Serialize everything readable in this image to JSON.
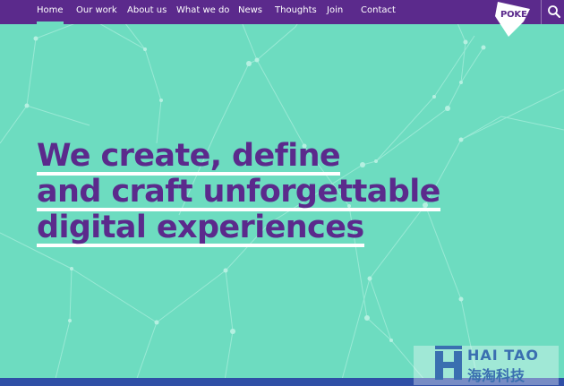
{
  "nav": {
    "items": [
      {
        "label": "Home",
        "active": true
      },
      {
        "label": "Our work",
        "active": false
      },
      {
        "label": "About us",
        "active": false
      },
      {
        "label": "What we do",
        "active": false
      },
      {
        "label": "News",
        "active": false
      },
      {
        "label": "Thoughts",
        "active": false
      },
      {
        "label": "Join",
        "active": false
      },
      {
        "label": "Contact",
        "active": false
      }
    ]
  },
  "logo": {
    "text": "POKE"
  },
  "search": {
    "icon": "search-icon"
  },
  "hero": {
    "lines": [
      "We create, define",
      "and craft unforgettable",
      "digital experiences"
    ]
  },
  "watermark": {
    "top_text": "HAI TAO",
    "bottom_text": "海淘科技"
  },
  "colors": {
    "brand_purple": "#5b2a8c",
    "background_mint": "#6ddcc0",
    "footer_blue": "#2f4fa6"
  }
}
